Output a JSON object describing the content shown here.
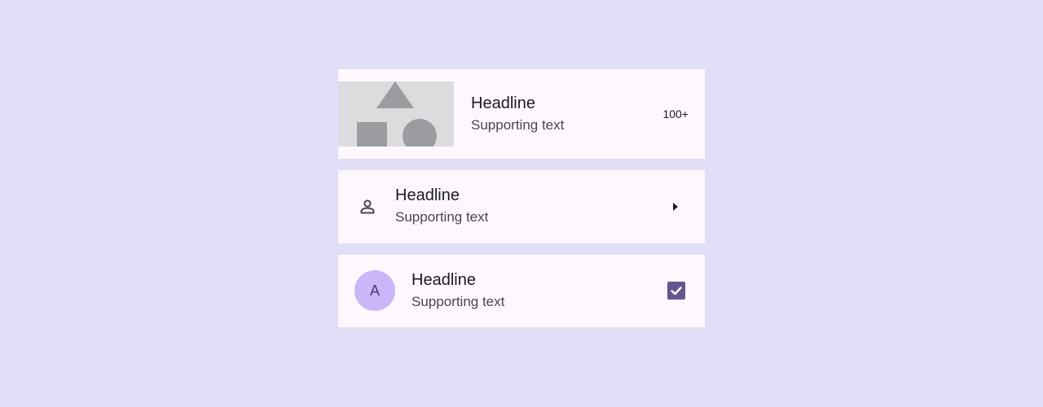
{
  "items": [
    {
      "headline": "Headline",
      "supporting": "Supporting text",
      "trailing": "100+",
      "leading": "image-thumbnail"
    },
    {
      "headline": "Headline",
      "supporting": "Supporting text",
      "leading": "person-icon",
      "trailing_icon": "arrow-right-icon"
    },
    {
      "headline": "Headline",
      "supporting": "Supporting text",
      "avatar_letter": "A",
      "checked": true
    }
  ],
  "colors": {
    "background": "#e1dff7",
    "surface": "#fff7fe",
    "avatar": "#cab6f8",
    "checkbox": "#65558f",
    "thumbnail_bg": "#dcdcde",
    "thumbnail_shapes": "#9a9ca0"
  }
}
